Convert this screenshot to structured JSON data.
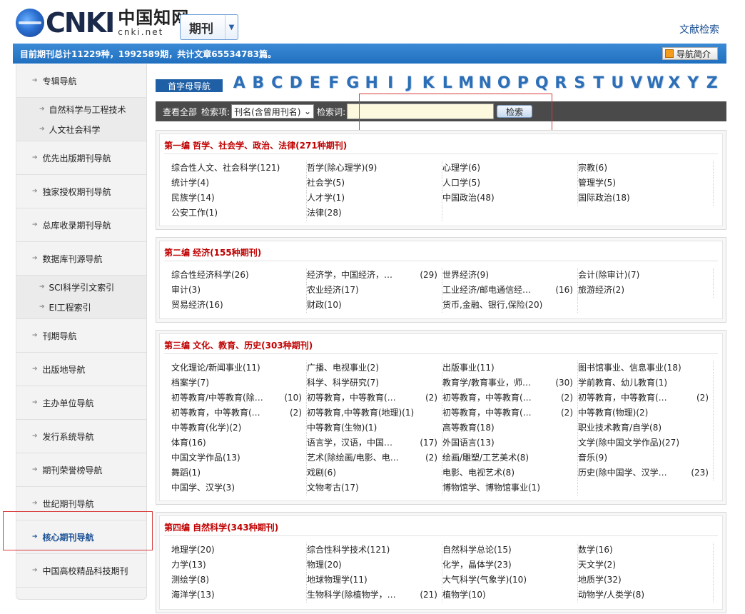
{
  "header": {
    "logo_brand": "CNKI",
    "logo_cn": "中国知网",
    "logo_en": "cnki.net",
    "journal_select": "期刊",
    "doc_search_link": "文献检索"
  },
  "banner": {
    "stats": "目前期刊总计11229种，1992589期，共计文章65534783篇。",
    "guide_btn": "导航简介"
  },
  "sidebar": {
    "items": [
      {
        "label": "专辑导航",
        "subs": [
          "自然科学与工程技术",
          "人文社会科学"
        ]
      },
      {
        "label": "优先出版期刊导航"
      },
      {
        "label": "独家授权期刊导航"
      },
      {
        "label": "总库收录期刊导航"
      },
      {
        "label": "数据库刊源导航",
        "subs": [
          "SCI科学引文索引",
          "EI工程索引"
        ]
      },
      {
        "label": "刊期导航"
      },
      {
        "label": "出版地导航"
      },
      {
        "label": "主办单位导航"
      },
      {
        "label": "发行系统导航"
      },
      {
        "label": "期刊荣誉榜导航"
      },
      {
        "label": "世纪期刊导航"
      },
      {
        "label": "核心期刊导航"
      },
      {
        "label": "中国高校精品科技期刊"
      }
    ]
  },
  "letter_nav": {
    "label": "首字母导航",
    "letters": [
      "A",
      "B",
      "C",
      "D",
      "E",
      "F",
      "G",
      "H",
      "I",
      "J",
      "K",
      "L",
      "M",
      "N",
      "O",
      "P",
      "Q",
      "R",
      "S",
      "T",
      "U",
      "V",
      "W",
      "X",
      "Y",
      "Z"
    ]
  },
  "search": {
    "view_all": "查看全部",
    "field_label": "检索项:",
    "field_value": "刊名(含曾用刊名)",
    "term_label": "检索词:",
    "term_value": "",
    "button": "检索"
  },
  "sections": [
    {
      "title": "第一编 哲学、社会学、政治、法律(271种期刊)",
      "items": [
        [
          "综合性人文、社会科学(121)",
          ""
        ],
        [
          "哲学(除心理学)(9)",
          ""
        ],
        [
          "心理学(6)",
          ""
        ],
        [
          "宗教(6)",
          ""
        ],
        [
          "统计学(4)",
          ""
        ],
        [
          "社会学(5)",
          ""
        ],
        [
          "人口学(5)",
          ""
        ],
        [
          "管理学(5)",
          ""
        ],
        [
          "民族学(14)",
          ""
        ],
        [
          "人才学(1)",
          ""
        ],
        [
          "中国政治(48)",
          ""
        ],
        [
          "国际政治(18)",
          ""
        ],
        [
          "公安工作(1)",
          ""
        ],
        [
          "法律(28)",
          ""
        ]
      ]
    },
    {
      "title": "第二编 经济(155种期刊)",
      "items": [
        [
          "综合性经济科学(26)",
          ""
        ],
        [
          "经济学，中国经济，…",
          "(29)"
        ],
        [
          "世界经济(9)",
          ""
        ],
        [
          "会计(除审计)(7)",
          ""
        ],
        [
          "审计(3)",
          ""
        ],
        [
          "农业经济(17)",
          ""
        ],
        [
          "工业经济/邮电通信经…",
          "(16)"
        ],
        [
          "旅游经济(2)",
          ""
        ],
        [
          "贸易经济(16)",
          ""
        ],
        [
          "财政(10)",
          ""
        ],
        [
          "货币,金融、银行,保险(20)",
          ""
        ]
      ]
    },
    {
      "title": "第三编 文化、教育、历史(303种期刊)",
      "items": [
        [
          "文化理论/新闻事业(11)",
          ""
        ],
        [
          "广播、电视事业(2)",
          ""
        ],
        [
          "出版事业(11)",
          ""
        ],
        [
          "图书馆事业、信息事业(18)",
          ""
        ],
        [
          "档案学(7)",
          ""
        ],
        [
          "科学、科学研究(7)",
          ""
        ],
        [
          "教育学/教育事业，师…",
          "(30)"
        ],
        [
          "学前教育、幼儿教育(1)",
          ""
        ],
        [
          "初等教育/中等教育(除…",
          "(10)"
        ],
        [
          "初等教育，中等教育(…",
          "(2)"
        ],
        [
          "初等教育，中等教育(…",
          "(2)"
        ],
        [
          "初等教育，中等教育(…",
          "(2)"
        ],
        [
          "初等教育，中等教育(…",
          "(2)"
        ],
        [
          "初等教育,中等教育(地理)(1)",
          ""
        ],
        [
          "初等教育，中等教育(…",
          "(2)"
        ],
        [
          "中等教育(物理)(2)",
          ""
        ],
        [
          "中等教育(化学)(2)",
          ""
        ],
        [
          "中等教育(生物)(1)",
          ""
        ],
        [
          "高等教育(18)",
          ""
        ],
        [
          "职业技术教育/自学(8)",
          ""
        ],
        [
          "体育(16)",
          ""
        ],
        [
          "语言学，汉语，中国…",
          "(17)"
        ],
        [
          "外国语言(13)",
          ""
        ],
        [
          "文学(除中国文学作品)(27)",
          ""
        ],
        [
          "中国文学作品(13)",
          ""
        ],
        [
          "艺术(除绘画/电影、电…",
          "(2)"
        ],
        [
          "绘画/雕塑/工艺美术(8)",
          ""
        ],
        [
          "音乐(9)",
          ""
        ],
        [
          "舞蹈(1)",
          ""
        ],
        [
          "戏剧(6)",
          ""
        ],
        [
          "电影、电视艺术(8)",
          ""
        ],
        [
          "历史(除中国学、汉学…",
          "(23)"
        ],
        [
          "中国学、汉学(3)",
          ""
        ],
        [
          "文物考古(17)",
          ""
        ],
        [
          "博物馆学、博物馆事业(1)",
          ""
        ]
      ]
    },
    {
      "title": "第四编 自然科学(343种期刊)",
      "items": [
        [
          "地理学(20)",
          ""
        ],
        [
          "综合性科学技术(121)",
          ""
        ],
        [
          "自然科学总论(15)",
          ""
        ],
        [
          "数学(16)",
          ""
        ],
        [
          "力学(13)",
          ""
        ],
        [
          "物理(20)",
          ""
        ],
        [
          "化学，晶体学(23)",
          ""
        ],
        [
          "天文学(2)",
          ""
        ],
        [
          "测绘学(8)",
          ""
        ],
        [
          "地球物理学(11)",
          ""
        ],
        [
          "大气科学(气象学)(10)",
          ""
        ],
        [
          "地质学(32)",
          ""
        ],
        [
          "海洋学(13)",
          ""
        ],
        [
          "生物科学(除植物学，…",
          "(21)"
        ],
        [
          "植物学(10)",
          ""
        ],
        [
          "动物学/人类学(8)",
          ""
        ]
      ]
    }
  ]
}
